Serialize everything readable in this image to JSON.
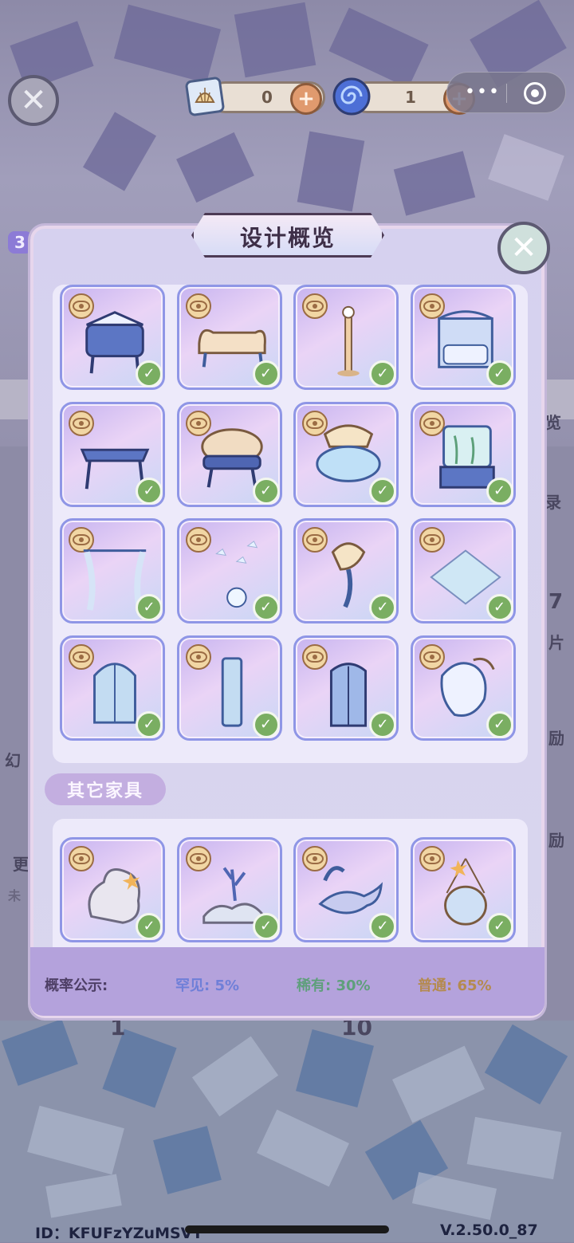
{
  "hud": {
    "close_label": "✕",
    "currency": [
      {
        "name": "shell-ticket",
        "value": "0",
        "plus": "+"
      },
      {
        "name": "spiral-gem",
        "value": "1",
        "plus": "+"
      }
    ],
    "menu_dots": "•••"
  },
  "background": {
    "left_label_top": "3",
    "left_labels": [
      "幻",
      "更",
      "未"
    ],
    "right_labels": [
      "览",
      "录",
      "7",
      "片",
      "励",
      "励"
    ],
    "bottom_counts": [
      "1",
      "10"
    ]
  },
  "modal": {
    "title": "设计概览",
    "close_label": "✕",
    "section_other": "其它家具",
    "design_items": [
      {
        "name": "shell-vanity",
        "checked": true
      },
      {
        "name": "chaise-lounge",
        "checked": true
      },
      {
        "name": "floor-lamp",
        "checked": true
      },
      {
        "name": "canopy-bed",
        "checked": true
      },
      {
        "name": "writing-desk",
        "checked": true
      },
      {
        "name": "tufted-ottoman",
        "checked": true
      },
      {
        "name": "shell-bathtub",
        "checked": true
      },
      {
        "name": "aquarium-cabinet",
        "checked": true
      },
      {
        "name": "sheer-curtains",
        "checked": true
      },
      {
        "name": "crystal-ball-fish",
        "checked": true
      },
      {
        "name": "shell-lamp",
        "checked": true
      },
      {
        "name": "glass-rug",
        "checked": true
      },
      {
        "name": "arched-window",
        "checked": true
      },
      {
        "name": "standing-mirror",
        "checked": true
      },
      {
        "name": "glass-door",
        "checked": true
      },
      {
        "name": "conch-mirror",
        "checked": true
      }
    ],
    "other_items": [
      {
        "name": "rock-sculpture",
        "checked": true
      },
      {
        "name": "coral-reef",
        "checked": true
      },
      {
        "name": "whale-decor",
        "checked": true
      },
      {
        "name": "hanging-basket",
        "checked": true
      }
    ],
    "probability": {
      "label": "概率公示:",
      "rare": "罕见: 5%",
      "uncommon": "稀有: 30%",
      "common": "普通: 65%",
      "colors": {
        "rare": "#6f7fd8",
        "uncommon": "#5f9f7c",
        "common": "#b48a4f"
      }
    },
    "check_glyph": "✓"
  },
  "footer": {
    "id": "ID：KFUFzYZuMSVT",
    "version": "V.2.50.0_87"
  }
}
